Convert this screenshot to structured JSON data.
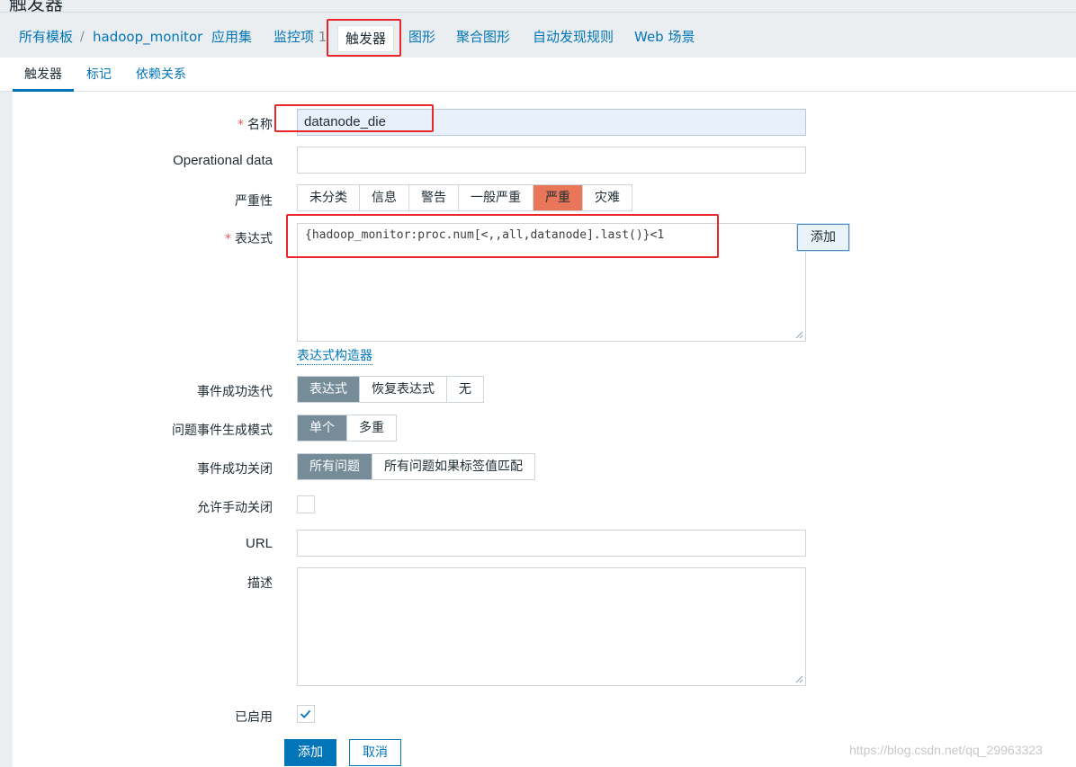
{
  "page_title": "触发器",
  "breadcrumb": {
    "root": "所有模板",
    "separator": "/",
    "template": "hadoop_monitor"
  },
  "nav": {
    "applications": "应用集",
    "items": "监控项",
    "items_count": "1",
    "triggers": "触发器",
    "graphs": "图形",
    "screens": "聚合图形",
    "discovery": "自动发现规则",
    "web": "Web 场景"
  },
  "tabs": [
    "触发器",
    "标记",
    "依赖关系"
  ],
  "form": {
    "required_mark": "*",
    "name_label": "名称",
    "name_value": "datanode_die",
    "opdata_label": "Operational data",
    "opdata_value": "",
    "severity_label": "严重性",
    "severity_options": [
      "未分类",
      "信息",
      "警告",
      "一般严重",
      "严重",
      "灾难"
    ],
    "severity_selected": "严重",
    "expression_label": "表达式",
    "expression_value": "{hadoop_monitor:proc.num[<,,all,datanode].last()}<1",
    "expression_add_button": "添加",
    "expression_constructor_link": "表达式构造器",
    "ok_event_label": "事件成功迭代",
    "ok_event_options": [
      "表达式",
      "恢复表达式",
      "无"
    ],
    "ok_event_selected": "表达式",
    "problem_mode_label": "问题事件生成模式",
    "problem_mode_options": [
      "单个",
      "多重"
    ],
    "problem_mode_selected": "单个",
    "ok_close_label": "事件成功关闭",
    "ok_close_options": [
      "所有问题",
      "所有问题如果标签值匹配"
    ],
    "ok_close_selected": "所有问题",
    "manual_close_label": "允许手动关闭",
    "manual_close_checked": false,
    "url_label": "URL",
    "url_value": "",
    "description_label": "描述",
    "description_value": "",
    "enabled_label": "已启用",
    "enabled_checked": true,
    "submit_button": "添加",
    "cancel_button": "取消"
  },
  "watermark": "https://blog.csdn.net/qq_29963323",
  "colors": {
    "accent": "#0275b8",
    "severity_high": "#e97659",
    "selected_gray": "#768d99",
    "highlight_box": "#e8262b",
    "focused_field_bg": "#e8f1fb"
  }
}
